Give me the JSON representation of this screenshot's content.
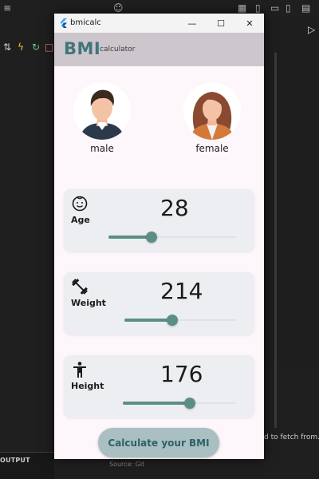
{
  "window": {
    "title": "bmicalc",
    "minimize_glyph": "—",
    "maximize_glyph": "☐",
    "close_glyph": "✕"
  },
  "appbar": {
    "brand": "BMI",
    "subtitle": "calculator"
  },
  "gender": {
    "male": {
      "label": "male",
      "icon": "male-avatar-icon"
    },
    "female": {
      "label": "female",
      "icon": "female-avatar-icon"
    }
  },
  "cards": {
    "age": {
      "title": "Age",
      "value": "28",
      "slider_fraction": 0.34,
      "icon": "baby-face-icon"
    },
    "weight": {
      "title": "Weight",
      "value": "214",
      "slider_fraction": 0.43,
      "icon": "dumbbell-icon"
    },
    "height": {
      "title": "Height",
      "value": "176",
      "slider_fraction": 0.59,
      "icon": "person-standing-icon"
    }
  },
  "calculate_button": {
    "label": "Calculate your BMI"
  },
  "ide": {
    "output_label": "OUTPUT",
    "fetch_text": "d to fetch from.",
    "source_text": "Source: Git"
  },
  "colors": {
    "accent": "#5b8e86",
    "brand": "#41757a",
    "appbar_bg": "#cdc6cc",
    "card_bg": "#eceef1",
    "button_bg": "#a9bfc1",
    "page_bg": "#fdf6fb"
  }
}
